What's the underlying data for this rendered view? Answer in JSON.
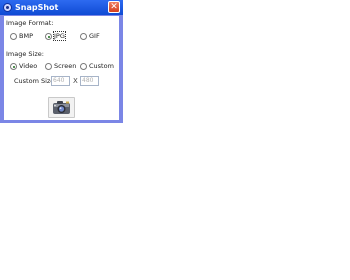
{
  "window": {
    "title": "SnapShot",
    "close_glyph": "✕"
  },
  "image_format": {
    "heading": "Image Format:",
    "options": [
      {
        "label": "BMP",
        "selected": false
      },
      {
        "label": "JPG",
        "selected": true
      },
      {
        "label": "GIF",
        "selected": false
      }
    ]
  },
  "image_size": {
    "heading": "Image Size:",
    "options": [
      {
        "label": "Video",
        "selected": true
      },
      {
        "label": "Screen",
        "selected": false
      },
      {
        "label": "Custom",
        "selected": false
      }
    ]
  },
  "custom_size": {
    "label": "Custom Size:",
    "width": "640",
    "separator": "X",
    "height": "480"
  },
  "capture_button": {
    "icon": "camera-icon"
  },
  "colors": {
    "window_frame": "#7b86e6",
    "title_bar": "#1f5be0",
    "close_button": "#e05a3a"
  }
}
